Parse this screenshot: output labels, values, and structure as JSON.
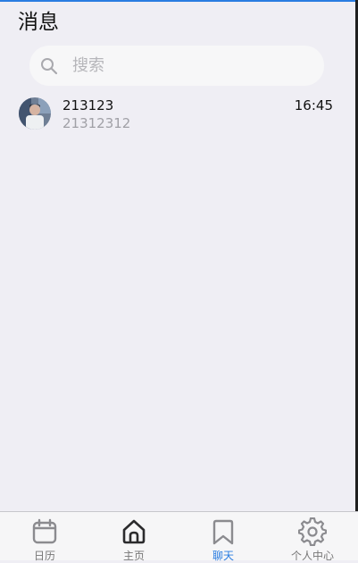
{
  "header": {
    "title": "消息"
  },
  "search": {
    "placeholder": "搜索"
  },
  "chats": [
    {
      "name": "213123",
      "preview": "21312312",
      "time": "16:45"
    }
  ],
  "tabs": [
    {
      "label": "日历",
      "icon": "calendar-icon",
      "active": false
    },
    {
      "label": "主页",
      "icon": "home-icon",
      "active": false
    },
    {
      "label": "聊天",
      "icon": "bookmark-icon",
      "active": true
    },
    {
      "label": "个人中心",
      "icon": "gear-icon",
      "active": false
    }
  ],
  "colors": {
    "background": "#efeef4",
    "accent": "#2a7de1",
    "tab_inactive": "#777777",
    "search_bg": "#f7f7f8"
  }
}
